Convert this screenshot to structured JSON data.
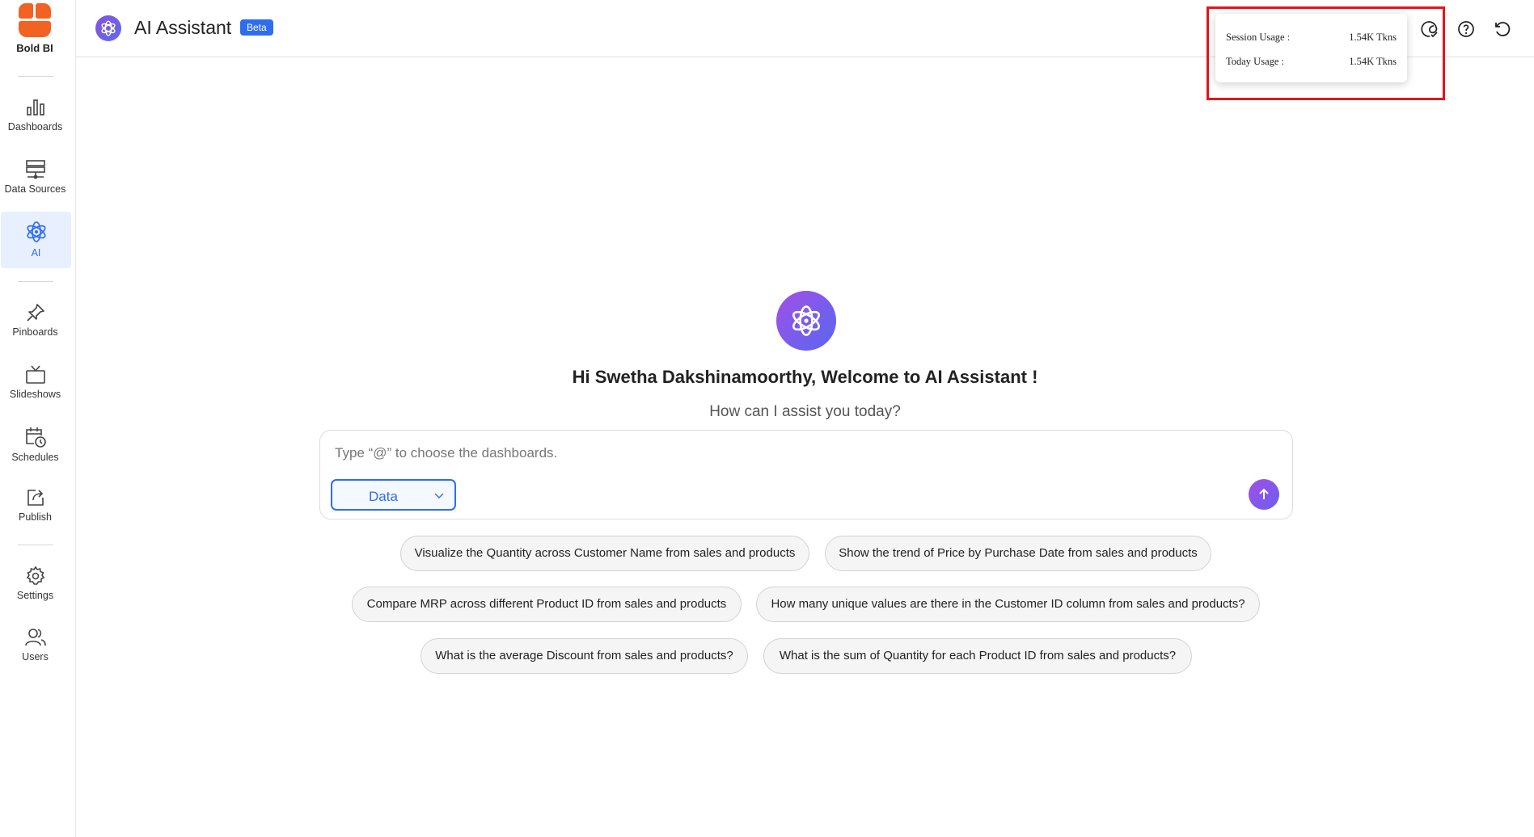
{
  "brand": {
    "name": "Bold BI",
    "color": "#f26222"
  },
  "sidebar": {
    "items": [
      {
        "label": "Dashboards",
        "icon": "bar-chart-icon"
      },
      {
        "label": "Data Sources",
        "icon": "server-icon"
      },
      {
        "label": "AI",
        "icon": "atom-icon",
        "active": true
      },
      {
        "label": "Pinboards",
        "icon": "pin-icon"
      },
      {
        "label": "Slideshows",
        "icon": "tv-icon"
      },
      {
        "label": "Schedules",
        "icon": "calendar-clock-icon"
      },
      {
        "label": "Publish",
        "icon": "publish-icon"
      },
      {
        "label": "Settings",
        "icon": "gear-icon"
      },
      {
        "label": "Users",
        "icon": "users-icon"
      }
    ]
  },
  "header": {
    "title": "AI Assistant",
    "badge": "Beta",
    "icons": [
      "usage-icon",
      "help-icon",
      "reset-icon"
    ]
  },
  "usage": {
    "session_label": "Session Usage :",
    "session_value": "1.54K Tkns",
    "today_label": "Today Usage :",
    "today_value": "1.54K Tkns"
  },
  "main": {
    "welcome": "Hi Swetha Dakshinamoorthy, Welcome to AI Assistant !",
    "subtitle": "How can I assist you today?",
    "input_placeholder": "Type “@” to choose the dashboards.",
    "source_selected": "Data",
    "suggestions": [
      "Visualize the Quantity across Customer Name from sales and products",
      "Show the trend of Price by Purchase Date from sales and products",
      "Compare MRP across different Product ID from sales and products",
      "How many unique values are there in the Customer ID column from sales and products?",
      "What is the average Discount from sales and products?",
      "What is the sum of Quantity for each Product ID from sales and products?"
    ]
  },
  "colors": {
    "accent": "#2f6df0",
    "gradient_start": "#a24fe6",
    "gradient_end": "#5867f2",
    "highlight": "#e8131b"
  }
}
